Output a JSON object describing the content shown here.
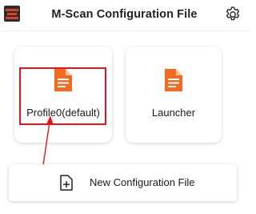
{
  "header": {
    "title": "M-Scan Configuration File",
    "logo_icon": "app-logo-icon",
    "settings_icon": "gear-icon"
  },
  "cards": [
    {
      "label": "Profile0(default)",
      "icon": "document-icon",
      "highlighted": true
    },
    {
      "label": "Launcher",
      "icon": "document-icon",
      "highlighted": false
    }
  ],
  "new_config": {
    "label": "New Configuration File",
    "icon": "add-document-icon"
  },
  "colors": {
    "accent": "#f26b21",
    "highlight": "#e4141b",
    "text": "#222222",
    "logo_bg": "#2b2b2b"
  }
}
